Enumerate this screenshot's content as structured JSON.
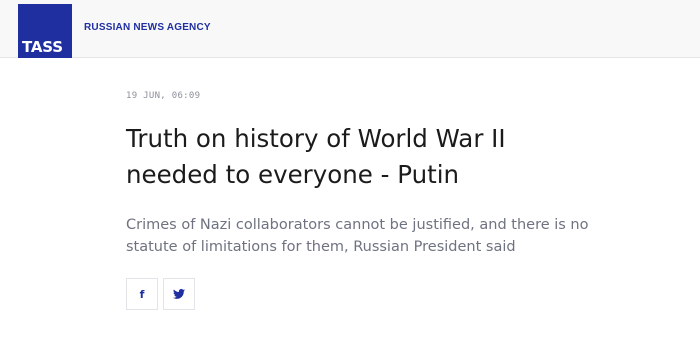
{
  "header": {
    "logo_text": "TASS",
    "agency_name": "RUSSIAN NEWS AGENCY",
    "colors": {
      "brand": "#1f2fa0",
      "background": "#f8f8f9"
    }
  },
  "article": {
    "date": "19 JUN, 06:09",
    "title_line1": "Truth on history of World War II",
    "title_line2": "needed to everyone - Putin",
    "lead_line1": "Crimes of Nazi collaborators cannot be justified, and there is no",
    "lead_line2": "statute of limitations for them, Russian President said"
  },
  "share": {
    "facebook_icon": "facebook-icon",
    "twitter_icon": "twitter-icon",
    "facebook_glyph": "f"
  }
}
